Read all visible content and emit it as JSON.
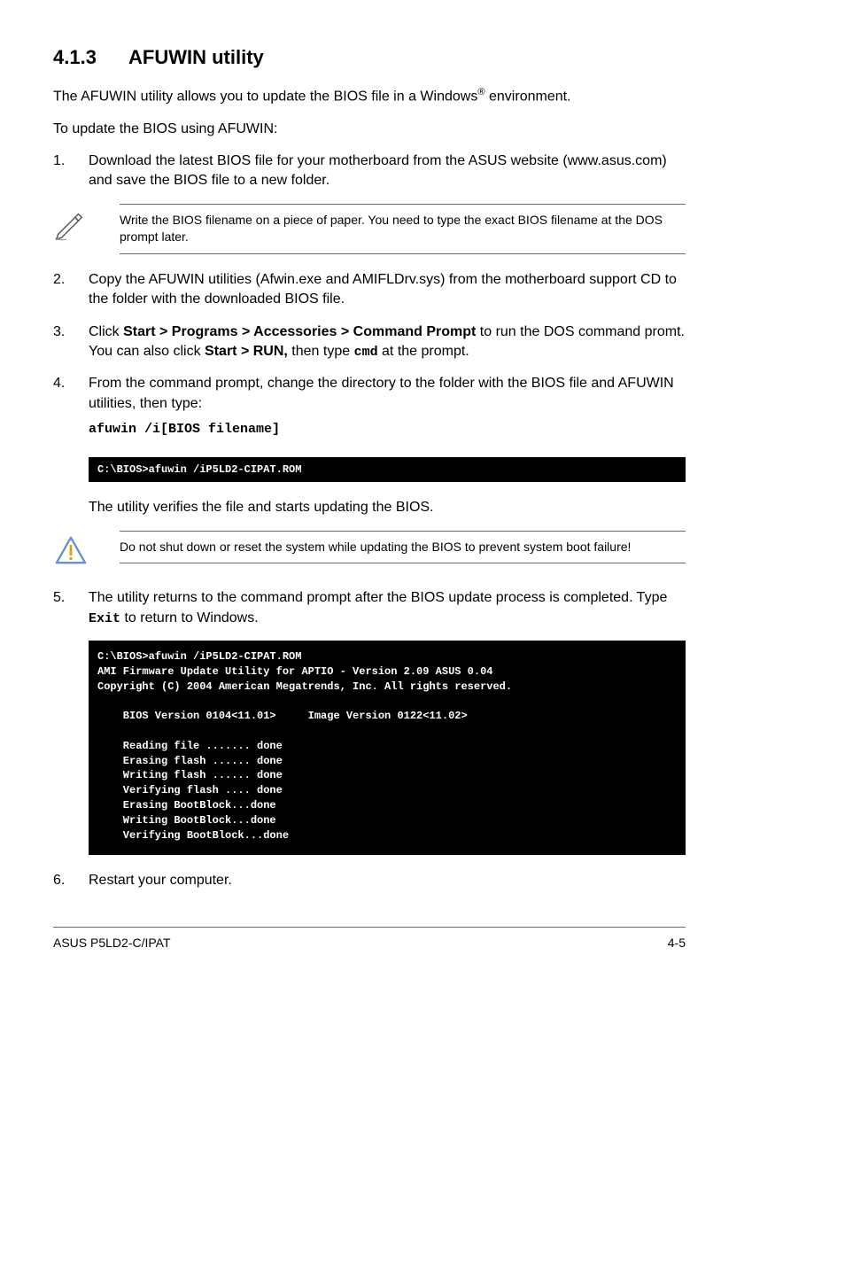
{
  "heading": {
    "num": "4.1.3",
    "title": "AFUWIN utility"
  },
  "intro1_a": "The AFUWIN utility allows you to update the BIOS file in a Windows",
  "intro1_b": " environment.",
  "intro2": "To update the BIOS using AFUWIN:",
  "step1": {
    "num": "1.",
    "text": "Download the latest BIOS file for your motherboard from the ASUS website (www.asus.com) and save the BIOS file to a new folder."
  },
  "note1": "Write the BIOS filename on a piece of paper. You need to type the exact BIOS filename at the DOS prompt later.",
  "step2": {
    "num": "2.",
    "text": "Copy the AFUWIN utilities (Afwin.exe and AMIFLDrv.sys) from the motherboard support CD to the folder with the downloaded BIOS file."
  },
  "step3": {
    "num": "3.",
    "pre": "Click ",
    "bold1": "Start > Programs > Accessories > Command Prompt",
    "mid": " to run the DOS command promt. You can also click ",
    "bold2": "Start > RUN,",
    "post1": " then type ",
    "code": "cmd",
    "post2": "  at the prompt."
  },
  "step4": {
    "num": "4.",
    "text": "From the command prompt, change the directory to the folder with the BIOS file and AFUWIN utilities, then type:",
    "cmd": "afuwin /i[BIOS filename]"
  },
  "terminal1": "C:\\BIOS>afuwin /iP5LD2-CIPAT.ROM",
  "verify": "The utility verifies the file and starts updating the BIOS.",
  "note2": "Do not shut down or reset the system while updating the BIOS to prevent system boot failure!",
  "step5": {
    "num": "5.",
    "pre": "The utility returns to the command prompt after the BIOS update process is completed. Type ",
    "code": "Exit",
    "post": " to return to Windows."
  },
  "terminal2": "C:\\BIOS>afuwin /iP5LD2-CIPAT.ROM\nAMI Firmware Update Utility for APTIO - Version 2.09 ASUS 0.04\nCopyright (C) 2004 American Megatrends, Inc. All rights reserved.\n\n    BIOS Version 0104<11.01>     Image Version 0122<11.02>\n\n    Reading file ....... done\n    Erasing flash ...... done\n    Writing flash ...... done\n    Verifying flash .... done\n    Erasing BootBlock...done\n    Writing BootBlock...done\n    Verifying BootBlock...done\n",
  "step6": {
    "num": "6.",
    "text": "Restart your computer."
  },
  "footer": {
    "left": "ASUS P5LD2-C/IPAT",
    "right": "4-5"
  }
}
